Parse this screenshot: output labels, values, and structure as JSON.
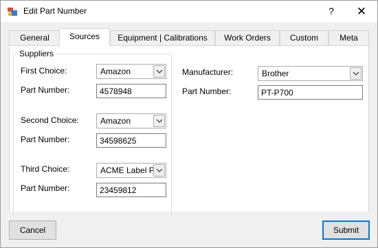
{
  "window": {
    "title": "Edit Part Number",
    "help_label": "?",
    "close_label": "✕"
  },
  "tabs": [
    {
      "label": "General"
    },
    {
      "label": "Sources",
      "active": true
    },
    {
      "label": "Equipment | Calibrations"
    },
    {
      "label": "Work Orders"
    },
    {
      "label": "Custom"
    },
    {
      "label": "Meta"
    }
  ],
  "suppliers": {
    "group_label": "Suppliers",
    "first": {
      "label": "First Choice:",
      "value": "Amazon",
      "part_label": "Part Number:",
      "part_number": "4578948"
    },
    "second": {
      "label": "Second Choice:",
      "value": "Amazon",
      "part_label": "Part Number:",
      "part_number": "34598625"
    },
    "third": {
      "label": "Third Choice:",
      "value": "ACME Label Pr",
      "part_label": "Part Number:",
      "part_number": "23459812"
    }
  },
  "manufacturer": {
    "label": "Manufacturer:",
    "value": "Brother",
    "part_label": "Part Number:",
    "part_number": "PT-P700"
  },
  "buttons": {
    "cancel": "Cancel",
    "submit": "Submit"
  },
  "colors": {
    "accent": "#0078d7",
    "panel": "#ffffff",
    "background": "#f0f0f0"
  }
}
